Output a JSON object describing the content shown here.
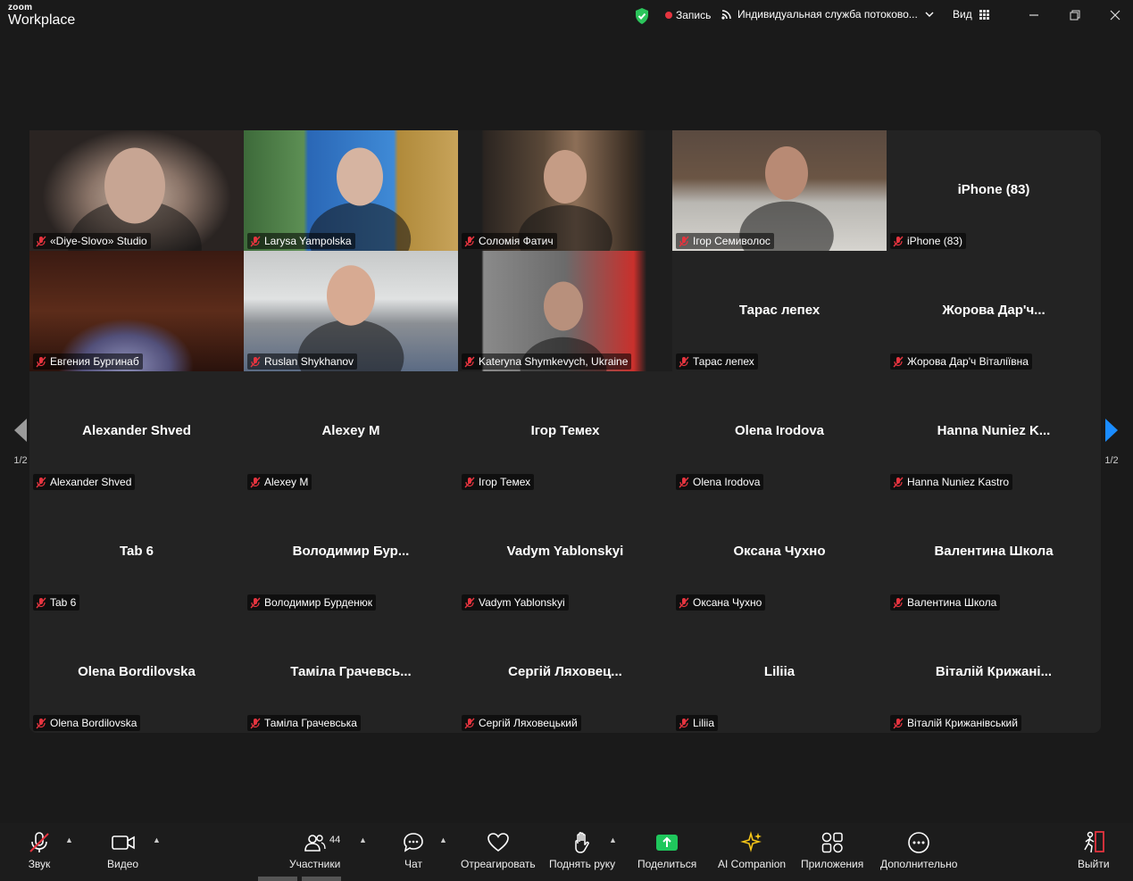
{
  "app": {
    "brand_small": "zoom",
    "brand_large": "Workplace"
  },
  "topbar": {
    "record_label": "Запись",
    "stream_label": "Индивидуальная служба потоково...",
    "view_label": "Вид"
  },
  "gallery": {
    "tiles": [
      {
        "name": "«Diye-Slovo» Studio",
        "center": "",
        "video": "v1",
        "active": true
      },
      {
        "name": "Larysa Yampolska",
        "center": "",
        "video": "v2"
      },
      {
        "name": "Соломія Фатич",
        "center": "",
        "video": "v3"
      },
      {
        "name": "Ігор Семиволос",
        "center": "",
        "video": "v4"
      },
      {
        "name": "iPhone (83)",
        "center": "iPhone (83)",
        "video": ""
      },
      {
        "name": "Евгения Бургинаб",
        "center": "",
        "video": "v6"
      },
      {
        "name": "Ruslan Shykhanov",
        "center": "",
        "video": "v7"
      },
      {
        "name": "Kateryna Shymkevych, Ukraine",
        "center": "",
        "video": "v8"
      },
      {
        "name": "Тарас лепех",
        "center": "Тарас лепех",
        "video": ""
      },
      {
        "name": "Жорова Дар'ч Віталіївна",
        "center": "Жорова  Дар'ч...",
        "video": ""
      },
      {
        "name": "Alexander Shved",
        "center": "Alexander Shved",
        "video": ""
      },
      {
        "name": "Alexey M",
        "center": "Alexey M",
        "video": ""
      },
      {
        "name": "Ігор Темех",
        "center": "Ігор Темех",
        "video": ""
      },
      {
        "name": "Olena Irodova",
        "center": "Olena Irodova",
        "video": ""
      },
      {
        "name": "Hanna Nuniez Kastro",
        "center": "Hanna  Nuniez  K...",
        "video": ""
      },
      {
        "name": "Tab 6",
        "center": "Tab 6",
        "video": ""
      },
      {
        "name": "Володимир Бурденюк",
        "center": "Володимир  Бур...",
        "video": ""
      },
      {
        "name": "Vadym Yablonskyi",
        "center": "Vadym Yablonskyi",
        "video": ""
      },
      {
        "name": "Оксана Чухно",
        "center": "Оксана Чухно",
        "video": ""
      },
      {
        "name": "Валентина Школа",
        "center": "Валентина Школа",
        "video": ""
      },
      {
        "name": "Olena Bordilovska",
        "center": "Olena Bordilovska",
        "video": ""
      },
      {
        "name": "Таміла Грачевська",
        "center": "Таміла  Грачевсь...",
        "video": ""
      },
      {
        "name": "Сергій Ляховецький",
        "center": "Сергій  Ляховец...",
        "video": ""
      },
      {
        "name": "Liliia",
        "center": "Liliia",
        "video": ""
      },
      {
        "name": "Віталій Крижанівський",
        "center": "Віталій  Крижані...",
        "video": ""
      }
    ],
    "page_left": "1/2",
    "page_right": "1/2"
  },
  "toolbar": {
    "audio": "Звук",
    "video": "Видео",
    "participants": "Участники",
    "participants_count": "44",
    "chat": "Чат",
    "react": "Отреагировать",
    "raise_hand": "Поднять руку",
    "share": "Поделиться",
    "ai": "AI Companion",
    "apps": "Приложения",
    "more": "Дополнительно",
    "leave": "Выйти"
  },
  "colors": {
    "active_border": "#2bd46d",
    "mute_red": "#e5343f",
    "share_green": "#1fc75c",
    "ai_yellow": "#f5c518",
    "leave_red": "#e5343f",
    "arrow_blue": "#1a8cff"
  }
}
